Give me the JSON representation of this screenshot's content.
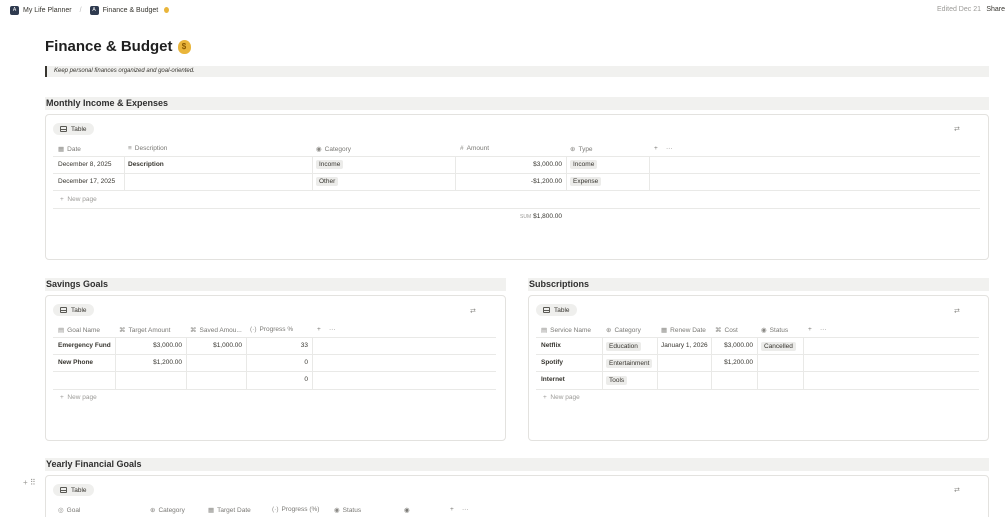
{
  "topbar": {
    "crumb1": "My Life Planner",
    "crumb2": "Finance & Budget",
    "edited": "Edited Dec 21",
    "share": "Share"
  },
  "page": {
    "title": "Finance & Budget",
    "quote": "Keep personal finances organized and goal-oriented."
  },
  "income": {
    "section": "Monthly Income & Expenses",
    "view": "Table",
    "columns": [
      "Date",
      "Description",
      "Category",
      "Amount",
      "Type"
    ],
    "rows": [
      {
        "date": "December 8, 2025",
        "desc": "Description",
        "category": "Income",
        "amount": "$3,000.00",
        "type": "Income"
      },
      {
        "date": "December 17, 2025",
        "desc": "",
        "category": "Other",
        "amount": "-$1,200.00",
        "type": "Expense"
      }
    ],
    "new_page": "New page",
    "sum_label": "SUM",
    "sum_value": "$1,800.00"
  },
  "savings": {
    "section": "Savings Goals",
    "view": "Table",
    "columns": [
      "Goal Name",
      "Target Amount",
      "Saved Amou...",
      "Progress %"
    ],
    "rows": [
      {
        "name": "Emergency Fund",
        "target": "$3,000.00",
        "saved": "$1,000.00",
        "progress": "33"
      },
      {
        "name": "New Phone",
        "target": "$1,200.00",
        "saved": "",
        "progress": "0"
      },
      {
        "name": "",
        "target": "",
        "saved": "",
        "progress": "0"
      }
    ],
    "new_page": "New page"
  },
  "subs": {
    "section": "Subscriptions",
    "view": "Table",
    "columns": [
      "Service Name",
      "Category",
      "Renew Date",
      "Cost",
      "Status"
    ],
    "rows": [
      {
        "name": "Netflix",
        "category": "Education",
        "renew": "January 1, 2026",
        "cost": "$3,000.00",
        "status": "Cancelled"
      },
      {
        "name": "Spotify",
        "category": "Entertainment",
        "renew": "",
        "cost": "$1,200.00",
        "status": ""
      },
      {
        "name": "Internet",
        "category": "Tools",
        "renew": "",
        "cost": "",
        "status": ""
      }
    ],
    "new_page": "New page"
  },
  "yearly": {
    "section": "Yearly Financial Goals",
    "view": "Table",
    "columns": [
      "Goal",
      "Category",
      "Target Date",
      "Progress (%)",
      "Status"
    ]
  }
}
